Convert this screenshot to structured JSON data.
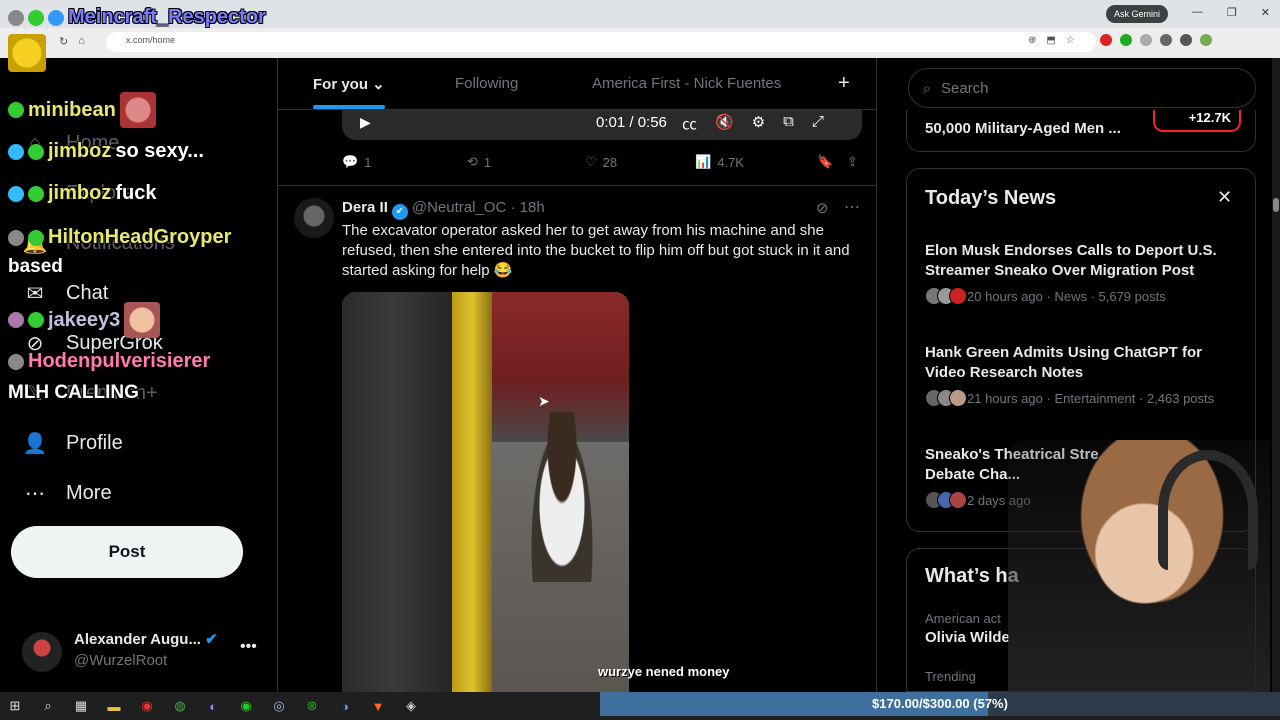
{
  "browser": {
    "ask_gemini": "Ask Gemini",
    "url": "x.com/home"
  },
  "sidebar": {
    "nav": [
      {
        "label": "Home",
        "icon": "home-icon"
      },
      {
        "label": "Explore",
        "icon": "search-icon"
      },
      {
        "label": "Notifications",
        "icon": "bell-icon"
      },
      {
        "label": "Chat",
        "icon": "chat-icon"
      },
      {
        "label": "SuperGrok",
        "icon": "grok-icon"
      },
      {
        "label": "Premium+",
        "icon": "x-icon"
      },
      {
        "label": "Profile",
        "icon": "person-icon"
      },
      {
        "label": "More",
        "icon": "more-icon"
      }
    ],
    "post_label": "Post",
    "account": {
      "name": "Alexander Augu...",
      "handle": "@WurzelRoot"
    }
  },
  "feed": {
    "tabs": [
      "For you",
      "Following",
      "America First - Nick Fuentes"
    ],
    "video": {
      "time": "0:01 / 0:56"
    },
    "prev_actions": {
      "replies": "1",
      "reposts": "1",
      "likes": "28",
      "views": "4.7K"
    },
    "tweet": {
      "name": "Dera II",
      "handle": "@Neutral_OC",
      "age": "18h",
      "text": "The excavator operator asked her to get away from his machine and she refused, then she entered into the bucket to flip him off but got stuck in it and started asking for help 😂"
    }
  },
  "right": {
    "search_placeholder": "Search",
    "top_trend": {
      "title": "50,000 Military-Aged Men ...",
      "badge": "+12.7K"
    },
    "news": {
      "header": "Today’s News",
      "items": [
        {
          "title": "Elon Musk Endorses Calls to Deport U.S. Streamer Sneako Over Migration Post",
          "meta": "20 hours ago · News · 5,679 posts"
        },
        {
          "title": "Hank Green Admits Using ChatGPT for Video Research Notes",
          "meta": "21 hours ago · Entertainment · 2,463 posts"
        },
        {
          "title": "Sneako's Theatrical Stre... Nick Fuentes Debate Cha...",
          "meta": "2 days ago"
        }
      ]
    },
    "whats": {
      "header": "What’s ha",
      "sub": "American act",
      "name": "Olivia Wilde",
      "trending": "Trending"
    }
  },
  "stream_overlay": {
    "chat": [
      {
        "user": "Meincraft_Respector",
        "msg": "",
        "color": "#7b7bff"
      },
      {
        "user": "minibean",
        "msg": "",
        "color": "#e8e870"
      },
      {
        "user": "jimboz",
        "msg": "so sexy...",
        "color": "#e8e870"
      },
      {
        "user": "jimboz",
        "msg": "fuck",
        "color": "#e8e870"
      },
      {
        "user": "HiltonHeadGroyper",
        "msg": "based",
        "color": "#e8e870"
      },
      {
        "user": "jakeey3",
        "msg": "",
        "color": "#c0c0e0"
      },
      {
        "user": "Hodenpulverisierer",
        "msg": "MLH CALLING",
        "color": "#ff7ab0"
      }
    ],
    "video_caption": "wurzye nened money",
    "goal": {
      "text": "$170.00/$300.00 (57%)",
      "progress": 0.57
    }
  },
  "colors": {
    "accent": "#1d9bf0",
    "background": "#000000",
    "danger": "#f4212e"
  }
}
